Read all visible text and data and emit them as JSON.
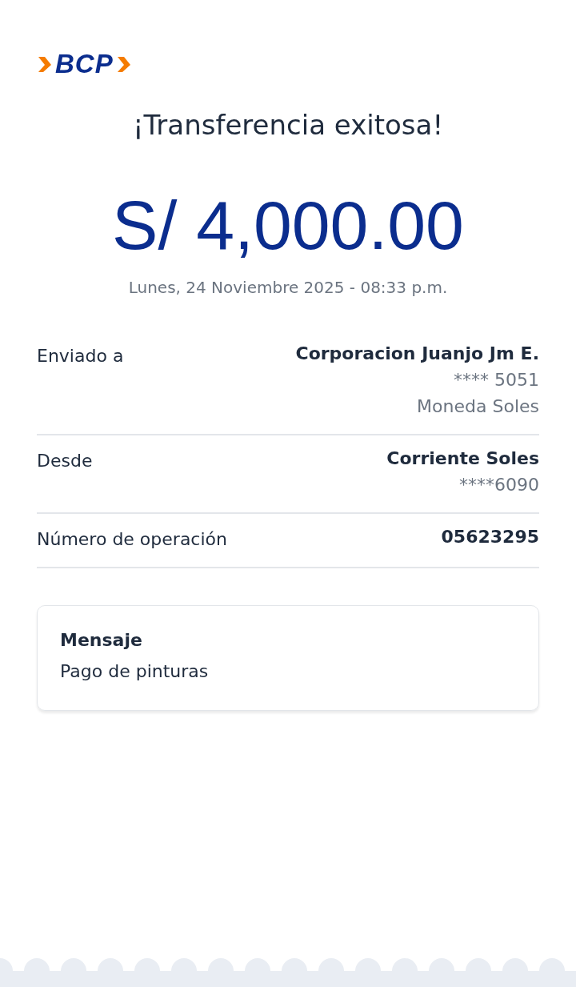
{
  "logo": {
    "text": "BCP"
  },
  "title": "¡Transferencia exitosa!",
  "amount": "S/ 4,000.00",
  "date": "Lunes, 24 Noviembre 2025 - 08:33 p.m.",
  "details": [
    {
      "label": "Enviado a",
      "lines": [
        {
          "text": "Corporacion Juanjo Jm E.",
          "kind": "strong"
        },
        {
          "text": "**** 5051",
          "kind": "muted"
        },
        {
          "text": "Moneda Soles",
          "kind": "muted"
        }
      ]
    },
    {
      "label": "Desde",
      "lines": [
        {
          "text": "Corriente Soles",
          "kind": "strong"
        },
        {
          "text": "****6090",
          "kind": "muted"
        }
      ]
    },
    {
      "label": "Número de operación",
      "lines": [
        {
          "text": "05623295",
          "kind": "strong"
        }
      ]
    }
  ],
  "message": {
    "heading": "Mensaje",
    "text": "Pago de pinturas"
  }
}
